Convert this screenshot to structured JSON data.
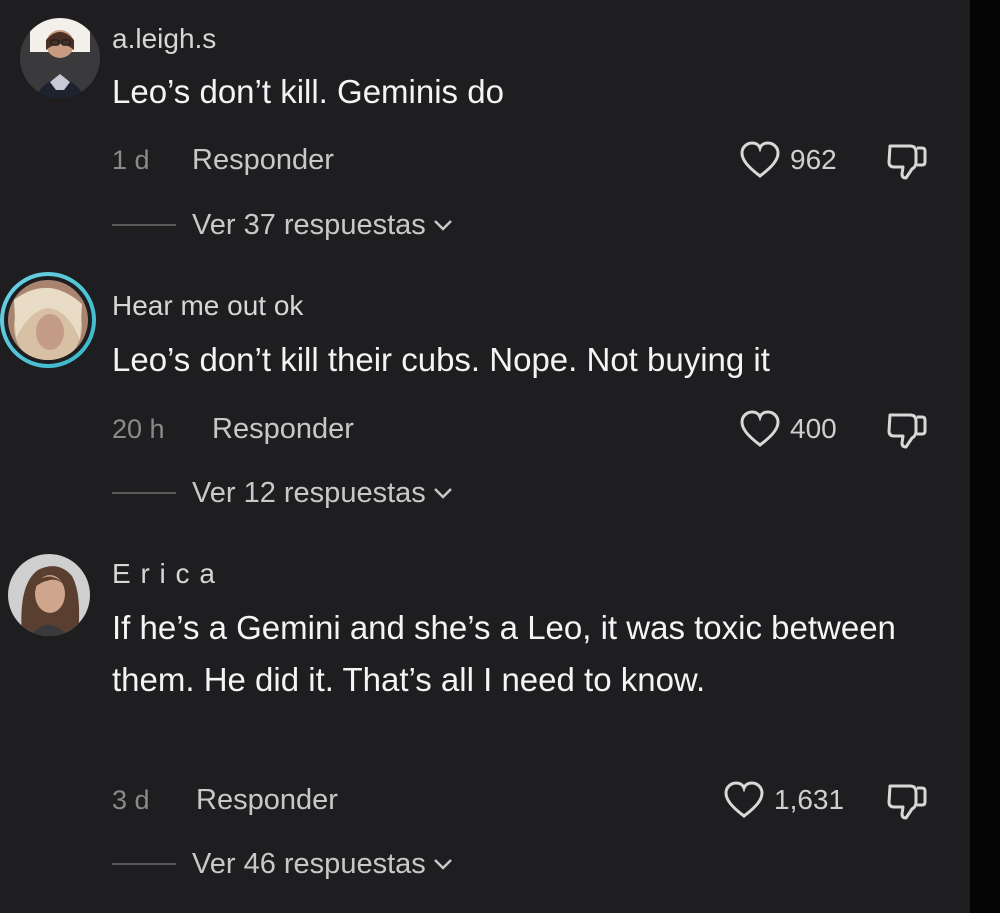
{
  "comments": [
    {
      "username": "a.leigh.s",
      "text": "Leo’s don’t kill. Geminis do",
      "time": "1 d",
      "reply_label": "Responder",
      "likes": "962",
      "view_replies": "Ver 37 respuestas"
    },
    {
      "username": "Hear me out ok",
      "text": "Leo’s don’t kill their cubs. Nope. Not buying it",
      "time": "20 h",
      "reply_label": "Responder",
      "likes": "400",
      "view_replies": "Ver 12 respuestas"
    },
    {
      "username": "E r i c a",
      "text": "If he’s a Gemini and she’s a Leo, it was toxic between them. He did it. That’s all I need to know.",
      "time": "3 d",
      "reply_label": "Responder",
      "likes": "1,631",
      "view_replies": "Ver 46 respuestas"
    }
  ],
  "colors": {
    "background": "#1e1e20",
    "story_ring_start": "#6fd3e6",
    "story_ring_end": "#36b5c8"
  },
  "icons": [
    "heart-icon",
    "dislike-icon",
    "chevron-down-icon"
  ]
}
